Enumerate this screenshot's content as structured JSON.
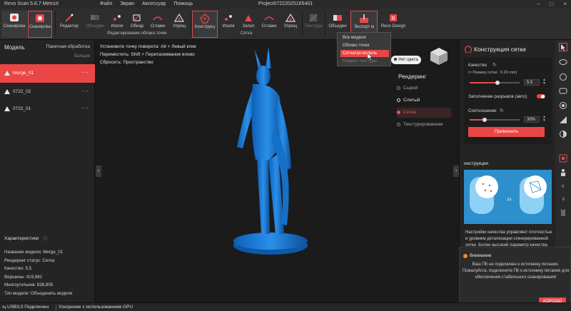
{
  "titlebar": {
    "app_name": "Revo Scan 5.6.7 MetroX",
    "menu": [
      "Файл",
      "Экран",
      "Аксессуар",
      "Помощь"
    ],
    "project": "Project07222025165401",
    "window_buttons": [
      "–",
      "□",
      "×"
    ]
  },
  "toolbar": {
    "scan1": "Сканирова",
    "scan2": "Сканирова",
    "edit": "Редактир",
    "merge": "Объедин",
    "isolate": "Изоля",
    "trim": "Обнар",
    "smooth": "Сглажи",
    "simplify": "Упрощ",
    "group_pointcloud": "Редактирование облака точек",
    "construct": "Конструкц",
    "isolate2": "Изоля",
    "fill": "Запол",
    "smooth2": "Сглажи",
    "simplify2": "Упрощ",
    "group_mesh": "Сетка",
    "texture": "Текстура",
    "merge2": "Объедин",
    "export": "Экспорт м",
    "revo_design": "Revo Design"
  },
  "dropdown": {
    "items": [
      "Все модели",
      "Облако точек",
      "Сетчатая модель",
      "Модель текстуры"
    ]
  },
  "left_panel": {
    "header": "Модель",
    "batch": "Пакетная обработка",
    "more": "Больше",
    "models": [
      {
        "name": "Merge_01",
        "selected": true
      },
      {
        "name": "0722_02",
        "selected": false
      },
      {
        "name": "0722_01",
        "selected": false
      }
    ],
    "characteristics_header": "Характеристики",
    "characteristics": [
      "Название модели:  Merge_01",
      "Рендеринг статус:  Сетка",
      "Качество:  5.5",
      "Вершины:  419,962",
      "Многоугольник:  838,805",
      "Тип модели:  Объединить модели"
    ]
  },
  "viewport": {
    "hints": [
      "Установите точку поворота: Alt + Левый клик",
      "Переместить: Shift + Перетаскивание влево",
      "Сбросить: Пространство"
    ],
    "no_color": "Нет цвета",
    "rendering_header": "Рендеринг",
    "rendering_options": [
      "Сырой",
      "Слитый",
      "Сетка",
      "Текстурированная"
    ],
    "rendering_selected": "Сетка",
    "model_color": "#1f7fd6"
  },
  "right_panel": {
    "title": "Конструкция сетки",
    "quality_label": "Качество",
    "mesh_size": "(≈ Размер сетки : 0.20 mm)",
    "quality_value": "5.5",
    "quality_level": 0.55,
    "fill_label": "Заполнение разрывов (авто)",
    "ratio_label": "Соотношение",
    "ratio_value": "30%",
    "ratio_level": 0.3,
    "apply": "Применить",
    "instructions_header": "инструкции",
    "instructions_text": "Настройки качества управляют плотностью и уровнем детализации сгенерированной сетки. Более высокий параметр качества приводит к более"
  },
  "toast": {
    "title": "Внимание",
    "text": "Ваш ПК не подключен к источнику питания. Пожалуйста, подключите ПК к источнику питания для обеспечения стабильного сканирования!",
    "button": "ХОРОШО"
  },
  "statusbar": {
    "usb": "USB3.0 Подключен",
    "gpu": "Ускорение с использованием GPU"
  },
  "colors": {
    "accent": "#ea4646",
    "panel": "#242424",
    "viewport": "#1b1b1b"
  }
}
